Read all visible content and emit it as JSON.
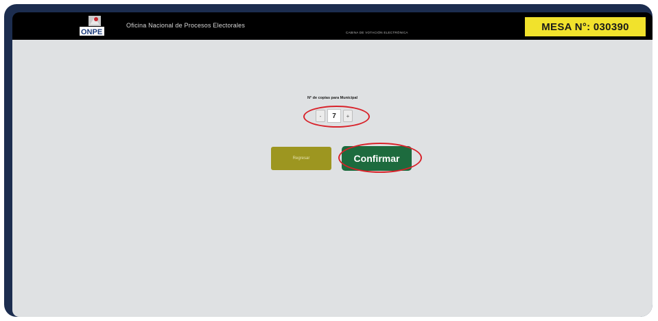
{
  "header": {
    "logo_text": "ONPE",
    "org_name": "Oficina Nacional de Procesos Electorales",
    "subtitle": "CABINA DE VOTACIÓN ELECTRÓNICA",
    "mesa_label": "MESA N°: 030390"
  },
  "main": {
    "copies_label": "N° de copias para Municipal",
    "stepper": {
      "decrement": "-",
      "value": "7",
      "increment": "+"
    },
    "buttons": {
      "back": "Regresar",
      "confirm": "Confirmar"
    }
  },
  "colors": {
    "frame": "#1c2d4f",
    "topbar": "#000000",
    "mesa_badge": "#f1e22c",
    "content_bg": "#dfe1e3",
    "back_button": "#9d9620",
    "confirm_button": "#1d6b3e",
    "highlight_ring": "#d8222a"
  }
}
